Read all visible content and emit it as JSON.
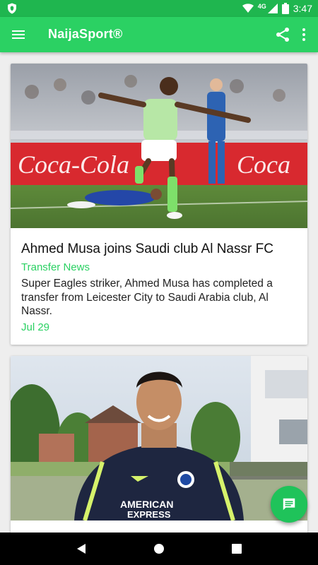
{
  "status_bar": {
    "time": "3:47",
    "network": "4G",
    "icons": [
      "shield-icon",
      "wifi-signal-icon",
      "cell-signal-icon",
      "battery-icon"
    ]
  },
  "app_bar": {
    "title": "NaijaSport®",
    "icons": [
      "menu-icon",
      "share-icon",
      "more-vert-icon"
    ],
    "color": "#2bd163"
  },
  "articles": [
    {
      "title": "Ahmed Musa joins Saudi club Al Nassr FC",
      "category": "Transfer News",
      "excerpt": "Super Eagles striker, Ahmed Musa has completed a transfer from Leicester City to Saudi Arabia club, Al Nassr.",
      "date": "Jul 29",
      "image": "footballer-celebrating-photo"
    },
    {
      "title": "",
      "image": "footballer-smiling-photo",
      "image_text": [
        "AMERICAN",
        "EXPRESS"
      ]
    }
  ],
  "fab": {
    "icon": "message-icon"
  },
  "nav_bar": {
    "icons": [
      "back-icon",
      "home-icon",
      "recents-icon"
    ]
  }
}
